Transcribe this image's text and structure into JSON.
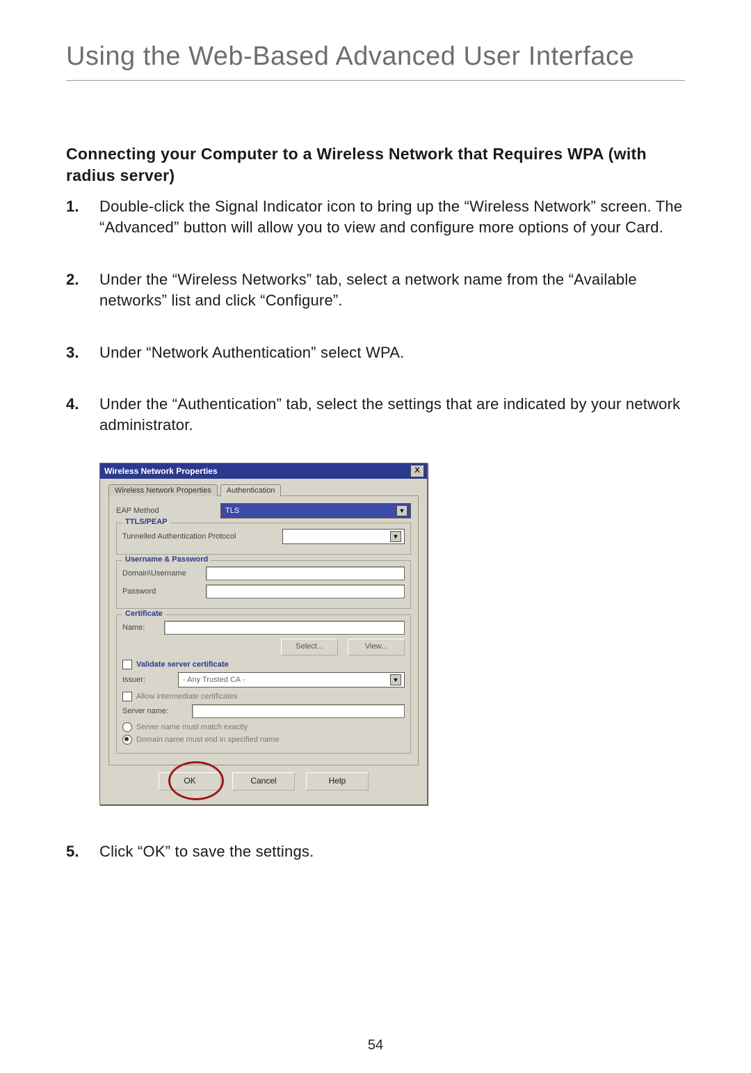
{
  "page": {
    "title": "Using the Web-Based Advanced User Interface",
    "number": "54"
  },
  "section_heading": "Connecting your Computer to a Wireless Network that Requires WPA (with radius server)",
  "steps": [
    {
      "num": "1.",
      "text": "Double-click the Signal Indicator icon to bring up the “Wireless Network” screen. The “Advanced” button will allow you to view and configure more options of your Card."
    },
    {
      "num": "2.",
      "text": "Under the “Wireless Networks” tab, select a network name from the “Available networks” list and click “Configure”."
    },
    {
      "num": "3.",
      "text": "Under “Network Authentication” select WPA."
    },
    {
      "num": "4.",
      "text": "Under the “Authentication” tab, select the settings that are indicated by your network administrator."
    },
    {
      "num": "5.",
      "text": "Click “OK” to save the settings."
    }
  ],
  "dialog": {
    "title": "Wireless Network Properties",
    "close": "X",
    "tabs": {
      "props": "Wireless Network Properties",
      "auth": "Authentication"
    },
    "eap_label": "EAP Method",
    "eap_value": "TLS",
    "group_ttls": "TTLS/PEAP",
    "tunnel_label": "Tunnelled Authentication Protocol",
    "tunnel_value": "",
    "group_userpass": "Username & Password",
    "domain_user_label": "Domain\\Username",
    "password_label": "Password",
    "group_cert": "Certificate",
    "cert_name_label": "Name:",
    "select_btn": "Select...",
    "view_btn": "View...",
    "validate_label": "Validate server certificate",
    "issuer_label": "Issuer:",
    "issuer_value": "- Any Trusted CA -",
    "allow_intermediate": "Allow intermediate certificates",
    "server_name_label": "Server name:",
    "radio1": "Server name must match exactly",
    "radio2": "Domain name must end in specified name",
    "buttons": {
      "ok": "OK",
      "cancel": "Cancel",
      "help": "Help"
    }
  }
}
